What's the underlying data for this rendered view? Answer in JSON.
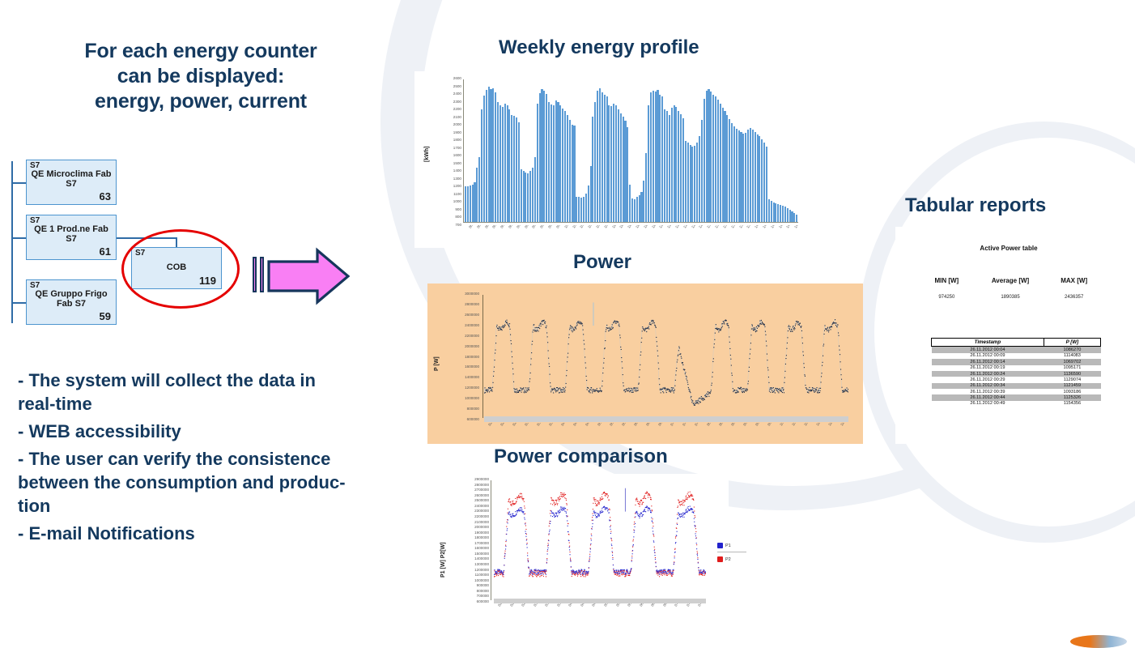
{
  "left": {
    "heading_lines": [
      "For each energy counter",
      "can be displayed:",
      "energy, power, current"
    ],
    "tree": {
      "nodes": [
        {
          "tag": "S7",
          "name": "QE Microclima Fab S7",
          "value": "63"
        },
        {
          "tag": "S7",
          "name": "QE 1 Prod.ne Fab S7",
          "value": "61"
        },
        {
          "tag": "S7",
          "name": "QE Gruppo Frigo Fab S7",
          "value": "59"
        },
        {
          "tag": "S7",
          "name": "COB",
          "value": "119"
        }
      ],
      "highlight_color": "#e50000"
    },
    "arrow": {
      "fill": "#f97ff4",
      "stroke": "#16365c"
    },
    "bullets": [
      "- The system will collect the data in real-time",
      "- WEB accessibility",
      "- The user can verify the consistence between the consumption and produc-tion",
      "- E-mail Notifications"
    ]
  },
  "sections": {
    "weekly_title": "Weekly energy profile",
    "power_title": "Power",
    "comparison_title": "Power comparison",
    "tabular_title": "Tabular reports"
  },
  "report": {
    "table_title": "Active Power table",
    "summary": [
      {
        "label": "MIN [W]",
        "value": "974250"
      },
      {
        "label": "Average [W]",
        "value": "1890385"
      },
      {
        "label": "MAX [W]",
        "value": "2436357"
      }
    ],
    "columns": [
      "Timestamp",
      "P [W]"
    ],
    "rows": [
      [
        "26.11.2012 00:04",
        "1086270"
      ],
      [
        "26.11.2012 00:09",
        "1114083"
      ],
      [
        "26.11.2012 00:14",
        "1069702"
      ],
      [
        "26.11.2012 00:19",
        "1095171"
      ],
      [
        "26.11.2012 00:24",
        "1136590"
      ],
      [
        "26.11.2012 00:29",
        "1129074"
      ],
      [
        "26.11.2012 00:34",
        "1121459"
      ],
      [
        "26.11.2012 00:39",
        "1093186"
      ],
      [
        "26.11.2012 00:44",
        "1125326"
      ],
      [
        "26.11.2012 00:49",
        "1154356"
      ]
    ]
  },
  "chart_data": [
    {
      "id": "weekly",
      "type": "bar",
      "title": "Weekly energy profile",
      "ylabel": "[kWh]",
      "xlabel": "",
      "ylim": [
        700,
        2600
      ],
      "yticks": [
        2600,
        2500,
        2400,
        2300,
        2200,
        2100,
        2000,
        1900,
        1800,
        1700,
        1600,
        1500,
        1400,
        1300,
        1200,
        1100,
        1000,
        900,
        800,
        700
      ],
      "grid": false,
      "bar_color": "#5b9bd5",
      "xtick_labels": [
        "08/11/12 00:00",
        "08/11/12 04:00",
        "08/11/12 08:00",
        "08/11/12 12:00",
        "08/11/12 16:00",
        "08/11/12 20:00",
        "09/11/12 00:00",
        "09/11/12 04:00",
        "09/11/12 08:00",
        "09/11/12 12:00",
        "09/11/12 16:00",
        "09/11/12 20:00",
        "10/11/12 00:00",
        "10/11/12 04:00",
        "10/11/12 08:00",
        "10/11/12 12:00",
        "10/11/12 16:00",
        "10/11/12 20:00",
        "11/11/12 00:00",
        "11/11/12 04:00",
        "11/11/12 08:00",
        "11/11/12 12:00",
        "11/11/12 16:00",
        "11/11/12 20:00",
        "12/11/12 00:00",
        "12/11/12 04:00",
        "12/11/12 08:00",
        "12/11/12 12:00",
        "12/11/12 16:00",
        "12/11/12 20:00",
        "13/11/12 00:00",
        "13/11/12 04:00",
        "13/11/12 08:00",
        "13/11/12 12:00",
        "13/11/12 16:00",
        "13/11/12 20:00",
        "14/11/12 00:00",
        "14/11/12 04:00",
        "14/11/12 08:00",
        "14/11/12 12:00",
        "14/11/12 16:00",
        "14/11/12 20:00"
      ],
      "values": [
        1180,
        1175,
        1190,
        1200,
        1230,
        1420,
        1560,
        2200,
        2380,
        2460,
        2500,
        2470,
        2480,
        2430,
        2300,
        2250,
        2230,
        2280,
        2250,
        2200,
        2130,
        2110,
        2090,
        2030,
        1400,
        1380,
        1360,
        1350,
        1380,
        1420,
        1560,
        2280,
        2420,
        2470,
        2450,
        2410,
        2300,
        2270,
        2250,
        2320,
        2300,
        2260,
        2210,
        2180,
        2120,
        2060,
        2000,
        1980,
        1040,
        1030,
        1020,
        1035,
        1080,
        1190,
        1450,
        2100,
        2300,
        2450,
        2480,
        2430,
        2400,
        2370,
        2260,
        2240,
        2280,
        2250,
        2200,
        2150,
        2100,
        2050,
        1960,
        1200,
        1010,
        1000,
        1030,
        1060,
        1100,
        1250,
        1620,
        2250,
        2430,
        2450,
        2440,
        2460,
        2400,
        2370,
        2200,
        2180,
        2130,
        2220,
        2260,
        2230,
        2180,
        2140,
        2080,
        1780,
        1760,
        1730,
        1700,
        1720,
        1760,
        1840,
        2060,
        2340,
        2450,
        2470,
        2440,
        2400,
        2370,
        2330,
        2280,
        2220,
        2180,
        2130,
        2070,
        2020,
        1970,
        1940,
        1920,
        1900,
        1880,
        1890,
        1930,
        1950,
        1930,
        1900,
        1870,
        1840,
        1800,
        1760,
        1700,
        1000,
        980,
        960,
        950,
        940,
        930,
        920,
        900,
        880,
        860,
        840,
        820,
        800
      ]
    },
    {
      "id": "power",
      "type": "scatter",
      "title": "Power",
      "ylabel": "P [W]",
      "xlabel": "",
      "ylim": [
        600000,
        3000000
      ],
      "yticks": [
        3000000,
        2800000,
        2600000,
        2400000,
        2200000,
        2000000,
        1800000,
        1600000,
        1400000,
        1200000,
        1000000,
        800000,
        600000
      ],
      "grid": false,
      "point_color": "#1b2a44",
      "plot_background": "#f9cfa0",
      "xtick_labels": [
        "02/11/12 00:14",
        "02/11/12 08:14",
        "02/11/12 16:14",
        "03/11/12 00:14",
        "03/11/12 08:14",
        "03/11/12 16:14",
        "04/11/12 00:14",
        "04/11/12 08:14",
        "04/11/12 16:14",
        "05/11/12 00:14",
        "05/11/12 08:14",
        "05/11/12 16:14",
        "06/11/12 00:14",
        "06/11/12 08:14",
        "06/11/12 16:14",
        "07/11/12 00:14",
        "07/11/12 08:14",
        "07/11/12 16:14",
        "08/11/12 00:14",
        "08/11/12 08:14",
        "08/11/12 16:14",
        "09/11/12 00:14",
        "09/11/12 08:14",
        "09/11/12 16:14",
        "10/11/12 00:14",
        "10/11/12 08:14",
        "10/11/12 16:14",
        "11/11/12 00:14",
        "11/11/12 08:14",
        "11/11/12 16:14"
      ],
      "cycles": 10,
      "peak_value": 2400000,
      "trough_value": 1150000,
      "weekend_dip_value": 900000
    },
    {
      "id": "power_comparison",
      "type": "scatter",
      "title": "Power comparison",
      "ylabel": "P1 [W] P2[W]",
      "xlabel": "",
      "ylim": [
        600000,
        2900000
      ],
      "yticks": [
        2900000,
        2800000,
        2700000,
        2600000,
        2500000,
        2400000,
        2300000,
        2200000,
        2100000,
        2000000,
        1900000,
        1800000,
        1700000,
        1600000,
        1500000,
        1400000,
        1300000,
        1200000,
        1100000,
        1000000,
        900000,
        800000,
        700000,
        600000
      ],
      "grid": false,
      "legend_position": "right",
      "series": [
        {
          "name": "P1",
          "color": "#2222cc",
          "peak_value": 2300000,
          "trough_value": 1150000
        },
        {
          "name": "P2",
          "color": "#e01b1b",
          "peak_value": 2550000,
          "trough_value": 1120000
        }
      ],
      "xtick_labels": [
        "02/11/12 00:14",
        "02/11/12 08:14",
        "02/11/12 16:14",
        "03/11/12 00:14",
        "03/11/12 08:14",
        "03/11/12 16:14",
        "04/11/12 00:14",
        "04/11/12 08:14",
        "04/11/12 16:14",
        "05/11/12 00:14",
        "05/11/12 08:14",
        "05/11/12 16:14",
        "06/11/12 00:14",
        "06/11/12 08:14",
        "06/11/12 16:14",
        "07/11/12 00:14",
        "07/11/12 08:14",
        "07/11/12 16:14"
      ],
      "cycles": 5
    }
  ]
}
